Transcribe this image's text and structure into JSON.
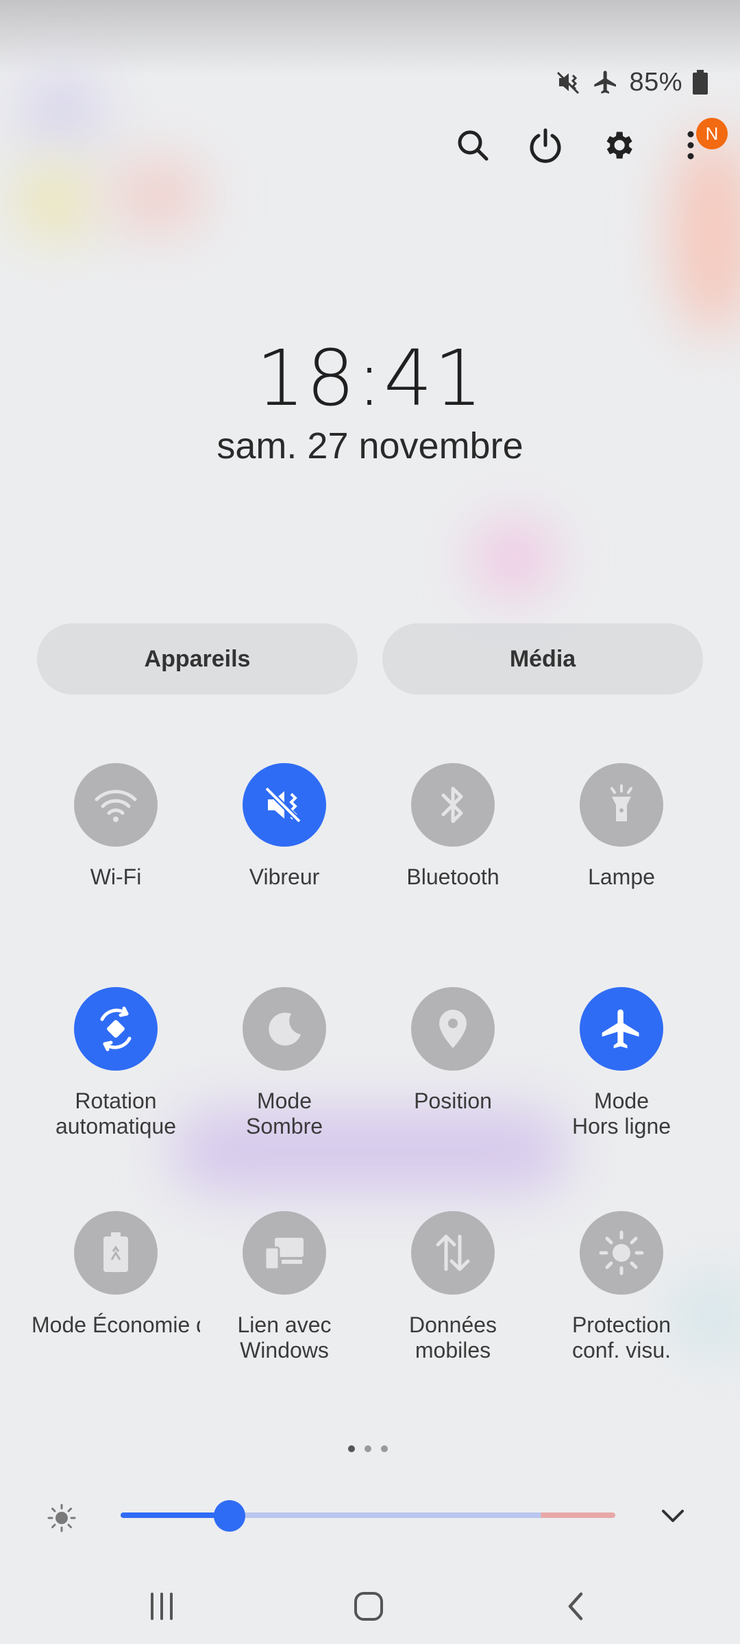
{
  "status_bar": {
    "icons": [
      "vibrate-mute-icon",
      "airplane-icon",
      "battery-icon"
    ],
    "battery": "85%"
  },
  "top_actions": {
    "items": [
      "search-icon",
      "power-icon",
      "settings-icon",
      "more-options-icon"
    ],
    "notification_badge": "N"
  },
  "clock": {
    "time": "18:41",
    "date": "sam. 27 novembre"
  },
  "buttons": {
    "devices": "Appareils",
    "media": "Média"
  },
  "tiles": [
    {
      "label": "Wi-Fi",
      "icon": "wifi-icon",
      "active": false
    },
    {
      "label": "Vibreur",
      "icon": "vibrate-mute-icon",
      "active": true
    },
    {
      "label": "Bluetooth",
      "icon": "bluetooth-icon",
      "active": false
    },
    {
      "label": "Lampe",
      "icon": "flashlight-icon",
      "active": false
    },
    {
      "label": "Rotation\nautomatique",
      "icon": "auto-rotate-icon",
      "active": true
    },
    {
      "label": "Mode\nSombre",
      "icon": "moon-icon",
      "active": false
    },
    {
      "label": "Position",
      "icon": "location-pin-icon",
      "active": false
    },
    {
      "label": "Mode\nHors ligne",
      "icon": "airplane-icon",
      "active": true
    },
    {
      "label": "Mode Économie d'énergie",
      "icon": "battery-saver-icon",
      "active": false
    },
    {
      "label": "Lien avec\nWindows",
      "icon": "link-windows-icon",
      "active": false
    },
    {
      "label": "Données\nmobiles",
      "icon": "mobile-data-icon",
      "active": false
    },
    {
      "label": "Protection\nconf. visu.",
      "icon": "eye-comfort-icon",
      "active": false
    }
  ],
  "pagination": {
    "pages": 3,
    "current": 1
  },
  "brightness": {
    "level": 0.22
  },
  "nav": [
    "recent-apps-icon",
    "home-icon",
    "back-icon"
  ],
  "colors": {
    "accent": "#2f6cf5",
    "badge": "#f26a12",
    "inactive_tile": "#b3b3b6"
  }
}
